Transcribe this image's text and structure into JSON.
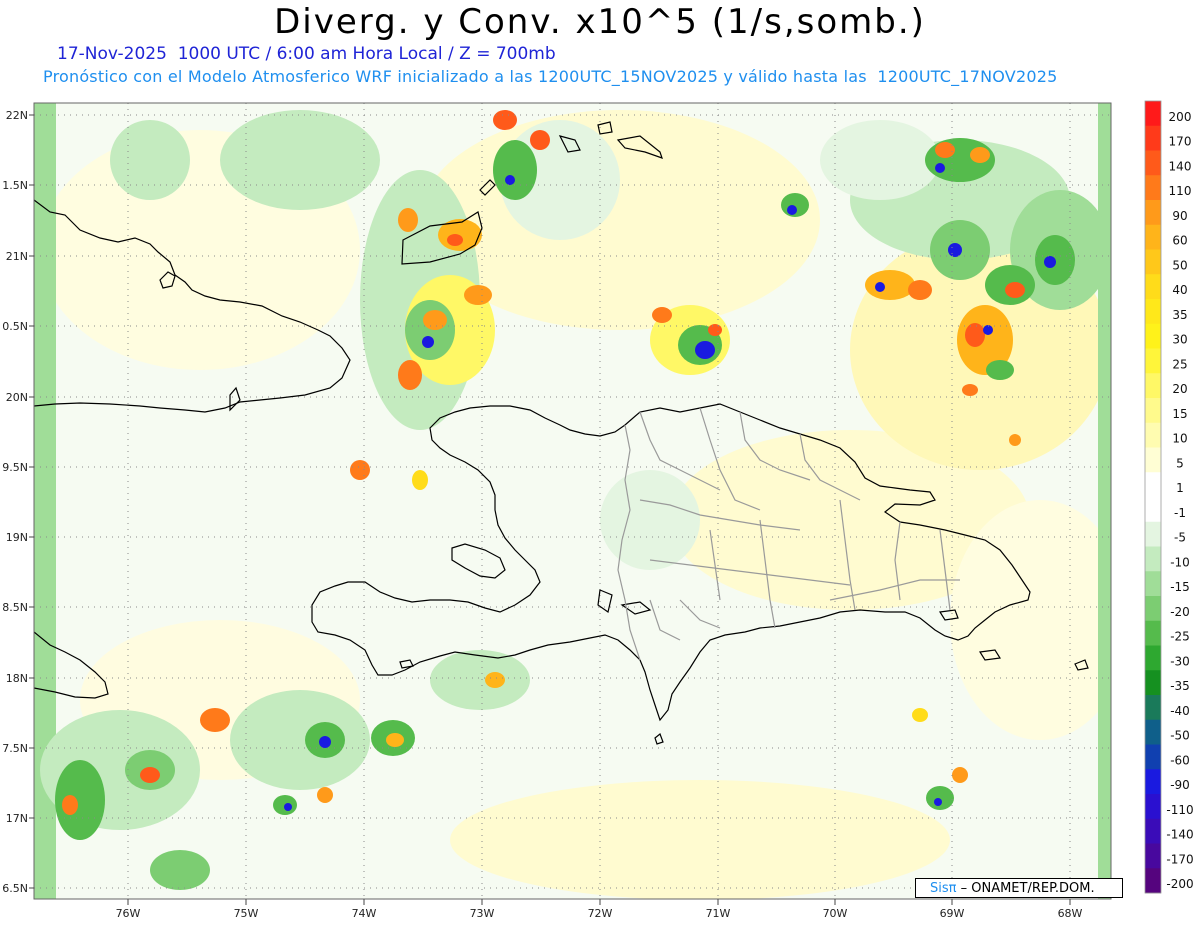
{
  "title": "Diverg. y Conv. x10^5 (1/s,somb.)",
  "subtitle_date": "17-Nov-2025  1000 UTC / 6:00 am Hora Local / Z = 700mb",
  "subtitle_model": "Pronóstico con el Modelo Atmosferico WRF inicializado a las 1200UTC_15NOV2025 y válido hasta las  1200UTC_17NOV2025",
  "credit": {
    "logo_text": "Sisπ",
    "source": " – ONAMET/REP.DOM."
  },
  "lat_labels": [
    "22N",
    "1.5N",
    "21N",
    "0.5N",
    "20N",
    "9.5N",
    "19N",
    "8.5N",
    "18N",
    "7.5N",
    "17N",
    "6.5N"
  ],
  "lon_labels": [
    "76W",
    "75W",
    "74W",
    "73W",
    "72W",
    "71W",
    "70W",
    "69W",
    "68W"
  ],
  "colorbar": {
    "labels": [
      "200",
      "170",
      "140",
      "110",
      "90",
      "60",
      "50",
      "40",
      "35",
      "30",
      "25",
      "20",
      "15",
      "10",
      "5",
      "1",
      "-1",
      "-5",
      "-10",
      "-15",
      "-20",
      "-25",
      "-30",
      "-35",
      "-40",
      "-50",
      "-60",
      "-90",
      "-110",
      "-140",
      "-170",
      "-200"
    ],
    "colors": [
      "#ff1a1a",
      "#ff3a1a",
      "#ff5a1a",
      "#ff7a1a",
      "#ff9a1a",
      "#ffb41a",
      "#ffc81a",
      "#ffdc1a",
      "#ffe81a",
      "#fff21a",
      "#fff53a",
      "#fff866",
      "#fffa8c",
      "#fffcb0",
      "#fffed4",
      "#ffffff",
      "#ffffff",
      "#e4f5e1",
      "#c4ebbf",
      "#a0dd98",
      "#7ccd72",
      "#55bb4c",
      "#2ea830",
      "#159020",
      "#1a7a5a",
      "#0f5f8a",
      "#1040b0",
      "#1a1ae0",
      "#2a10d0",
      "#3a0cb8",
      "#48089e",
      "#55047e"
    ]
  }
}
